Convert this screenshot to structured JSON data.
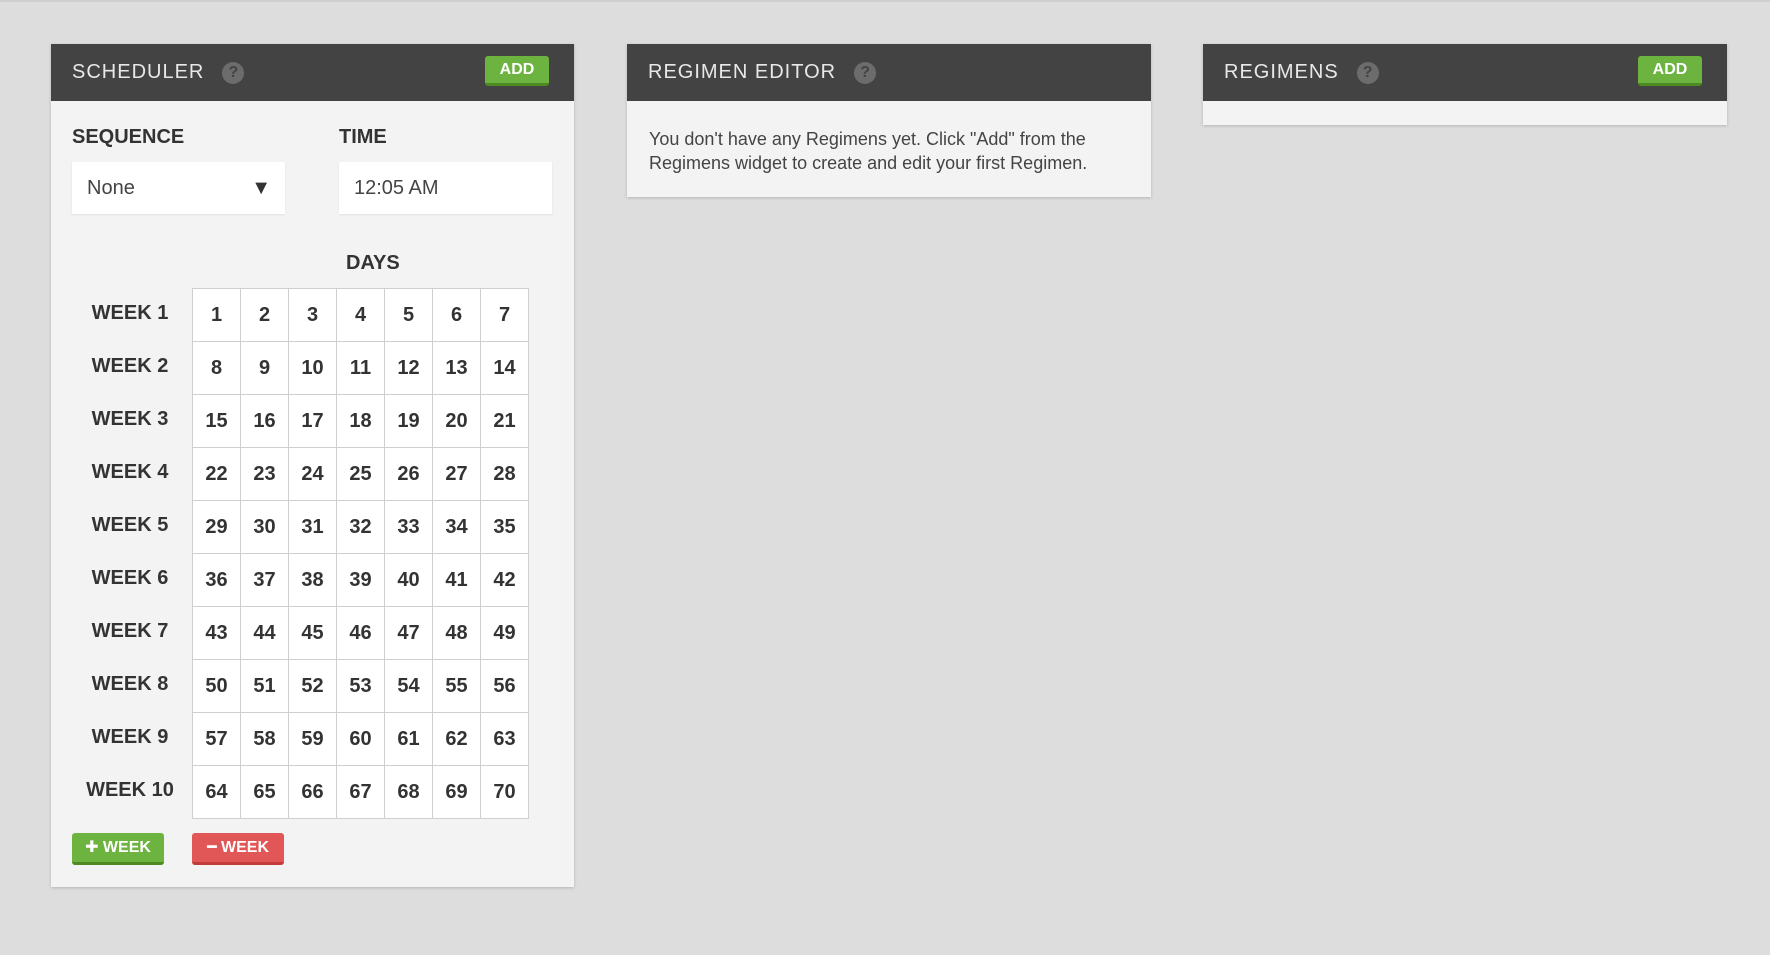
{
  "scheduler": {
    "title": "SCHEDULER",
    "help_icon": "?",
    "add_label": "ADD",
    "sequence_label": "SEQUENCE",
    "sequence_value": "None",
    "time_label": "TIME",
    "time_value": "12:05 AM",
    "days_label": "DAYS",
    "weeks": [
      {
        "label": "WEEK 1",
        "days": [
          "1",
          "2",
          "3",
          "4",
          "5",
          "6",
          "7"
        ]
      },
      {
        "label": "WEEK 2",
        "days": [
          "8",
          "9",
          "10",
          "11",
          "12",
          "13",
          "14"
        ]
      },
      {
        "label": "WEEK 3",
        "days": [
          "15",
          "16",
          "17",
          "18",
          "19",
          "20",
          "21"
        ]
      },
      {
        "label": "WEEK 4",
        "days": [
          "22",
          "23",
          "24",
          "25",
          "26",
          "27",
          "28"
        ]
      },
      {
        "label": "WEEK 5",
        "days": [
          "29",
          "30",
          "31",
          "32",
          "33",
          "34",
          "35"
        ]
      },
      {
        "label": "WEEK 6",
        "days": [
          "36",
          "37",
          "38",
          "39",
          "40",
          "41",
          "42"
        ]
      },
      {
        "label": "WEEK 7",
        "days": [
          "43",
          "44",
          "45",
          "46",
          "47",
          "48",
          "49"
        ]
      },
      {
        "label": "WEEK 8",
        "days": [
          "50",
          "51",
          "52",
          "53",
          "54",
          "55",
          "56"
        ]
      },
      {
        "label": "WEEK 9",
        "days": [
          "57",
          "58",
          "59",
          "60",
          "61",
          "62",
          "63"
        ]
      },
      {
        "label": "WEEK 10",
        "days": [
          "64",
          "65",
          "66",
          "67",
          "68",
          "69",
          "70"
        ]
      }
    ],
    "add_week_label": "✚ WEEK",
    "remove_week_label": "━ WEEK"
  },
  "regimen_editor": {
    "title": "REGIMEN EDITOR",
    "help_icon": "?",
    "message": "You don't have any Regimens yet. Click \"Add\" from the Regimens widget to create and edit your first Regimen."
  },
  "regimens": {
    "title": "REGIMENS",
    "help_icon": "?",
    "add_label": "ADD"
  },
  "colors": {
    "background": "#dddddd",
    "header": "#434343",
    "panel": "#f3f3f3",
    "green": "#6db33f",
    "red": "#e15656"
  }
}
